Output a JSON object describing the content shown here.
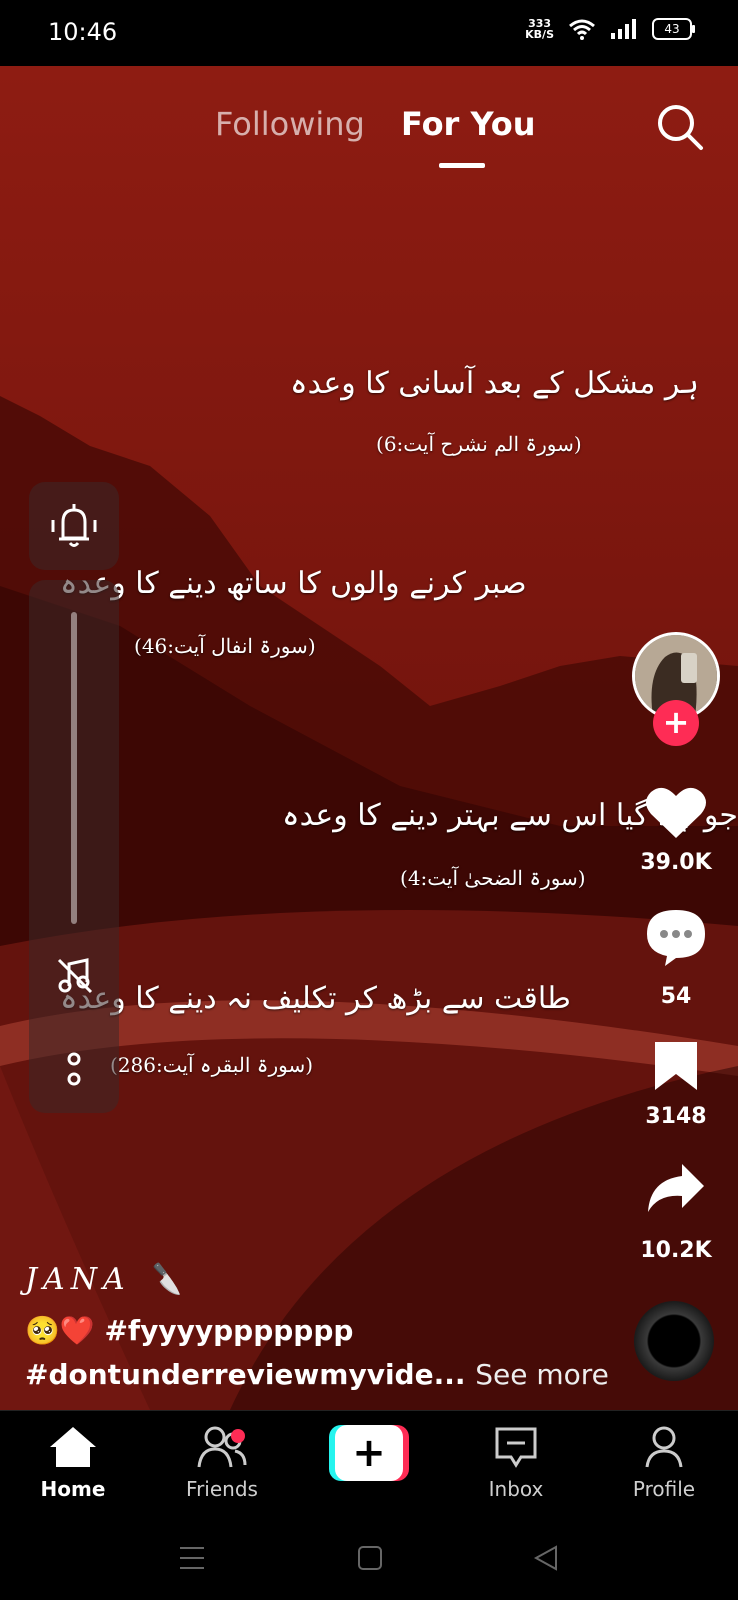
{
  "status": {
    "time": "10:46",
    "net_speed_value": "333",
    "net_speed_unit": "KB/S",
    "battery": "43"
  },
  "tabs": {
    "following": "Following",
    "for_you": "For You"
  },
  "video": {
    "lines": [
      {
        "text": "ہر مشکل کے بعد آسانی کا وعدہ",
        "ref": "(سورۃ الم نشرح آیت:6)"
      },
      {
        "text": "صبر کرنے والوں کا ساتھ دینے کا وعدہ",
        "ref": "(سورۃ انفال آیت:46)"
      },
      {
        "text": "جو چلا گیا اس سے بہتر دینے کا وعدہ",
        "ref": "(سورۃ الضحیٰ آیت:4)"
      },
      {
        "text": "طاقت سے بڑھ کر تکلیف نہ دینے کا وعدہ",
        "ref": "(سورۃ البقرہ آیت:286)"
      }
    ]
  },
  "rail": {
    "likes": "39.0K",
    "comments": "54",
    "saves": "3148",
    "shares": "10.2K"
  },
  "caption": {
    "username": "JANA 🔪",
    "line1": "🥺❤️ #fyyyyppppppp",
    "line2": "#dontunderreviewmyvide...",
    "see_more": "See more"
  },
  "nav": {
    "home": "Home",
    "friends": "Friends",
    "inbox": "Inbox",
    "profile": "Profile",
    "create": "+"
  },
  "colors": {
    "accent": "#fe2c55",
    "cyan": "#25f4ee"
  }
}
